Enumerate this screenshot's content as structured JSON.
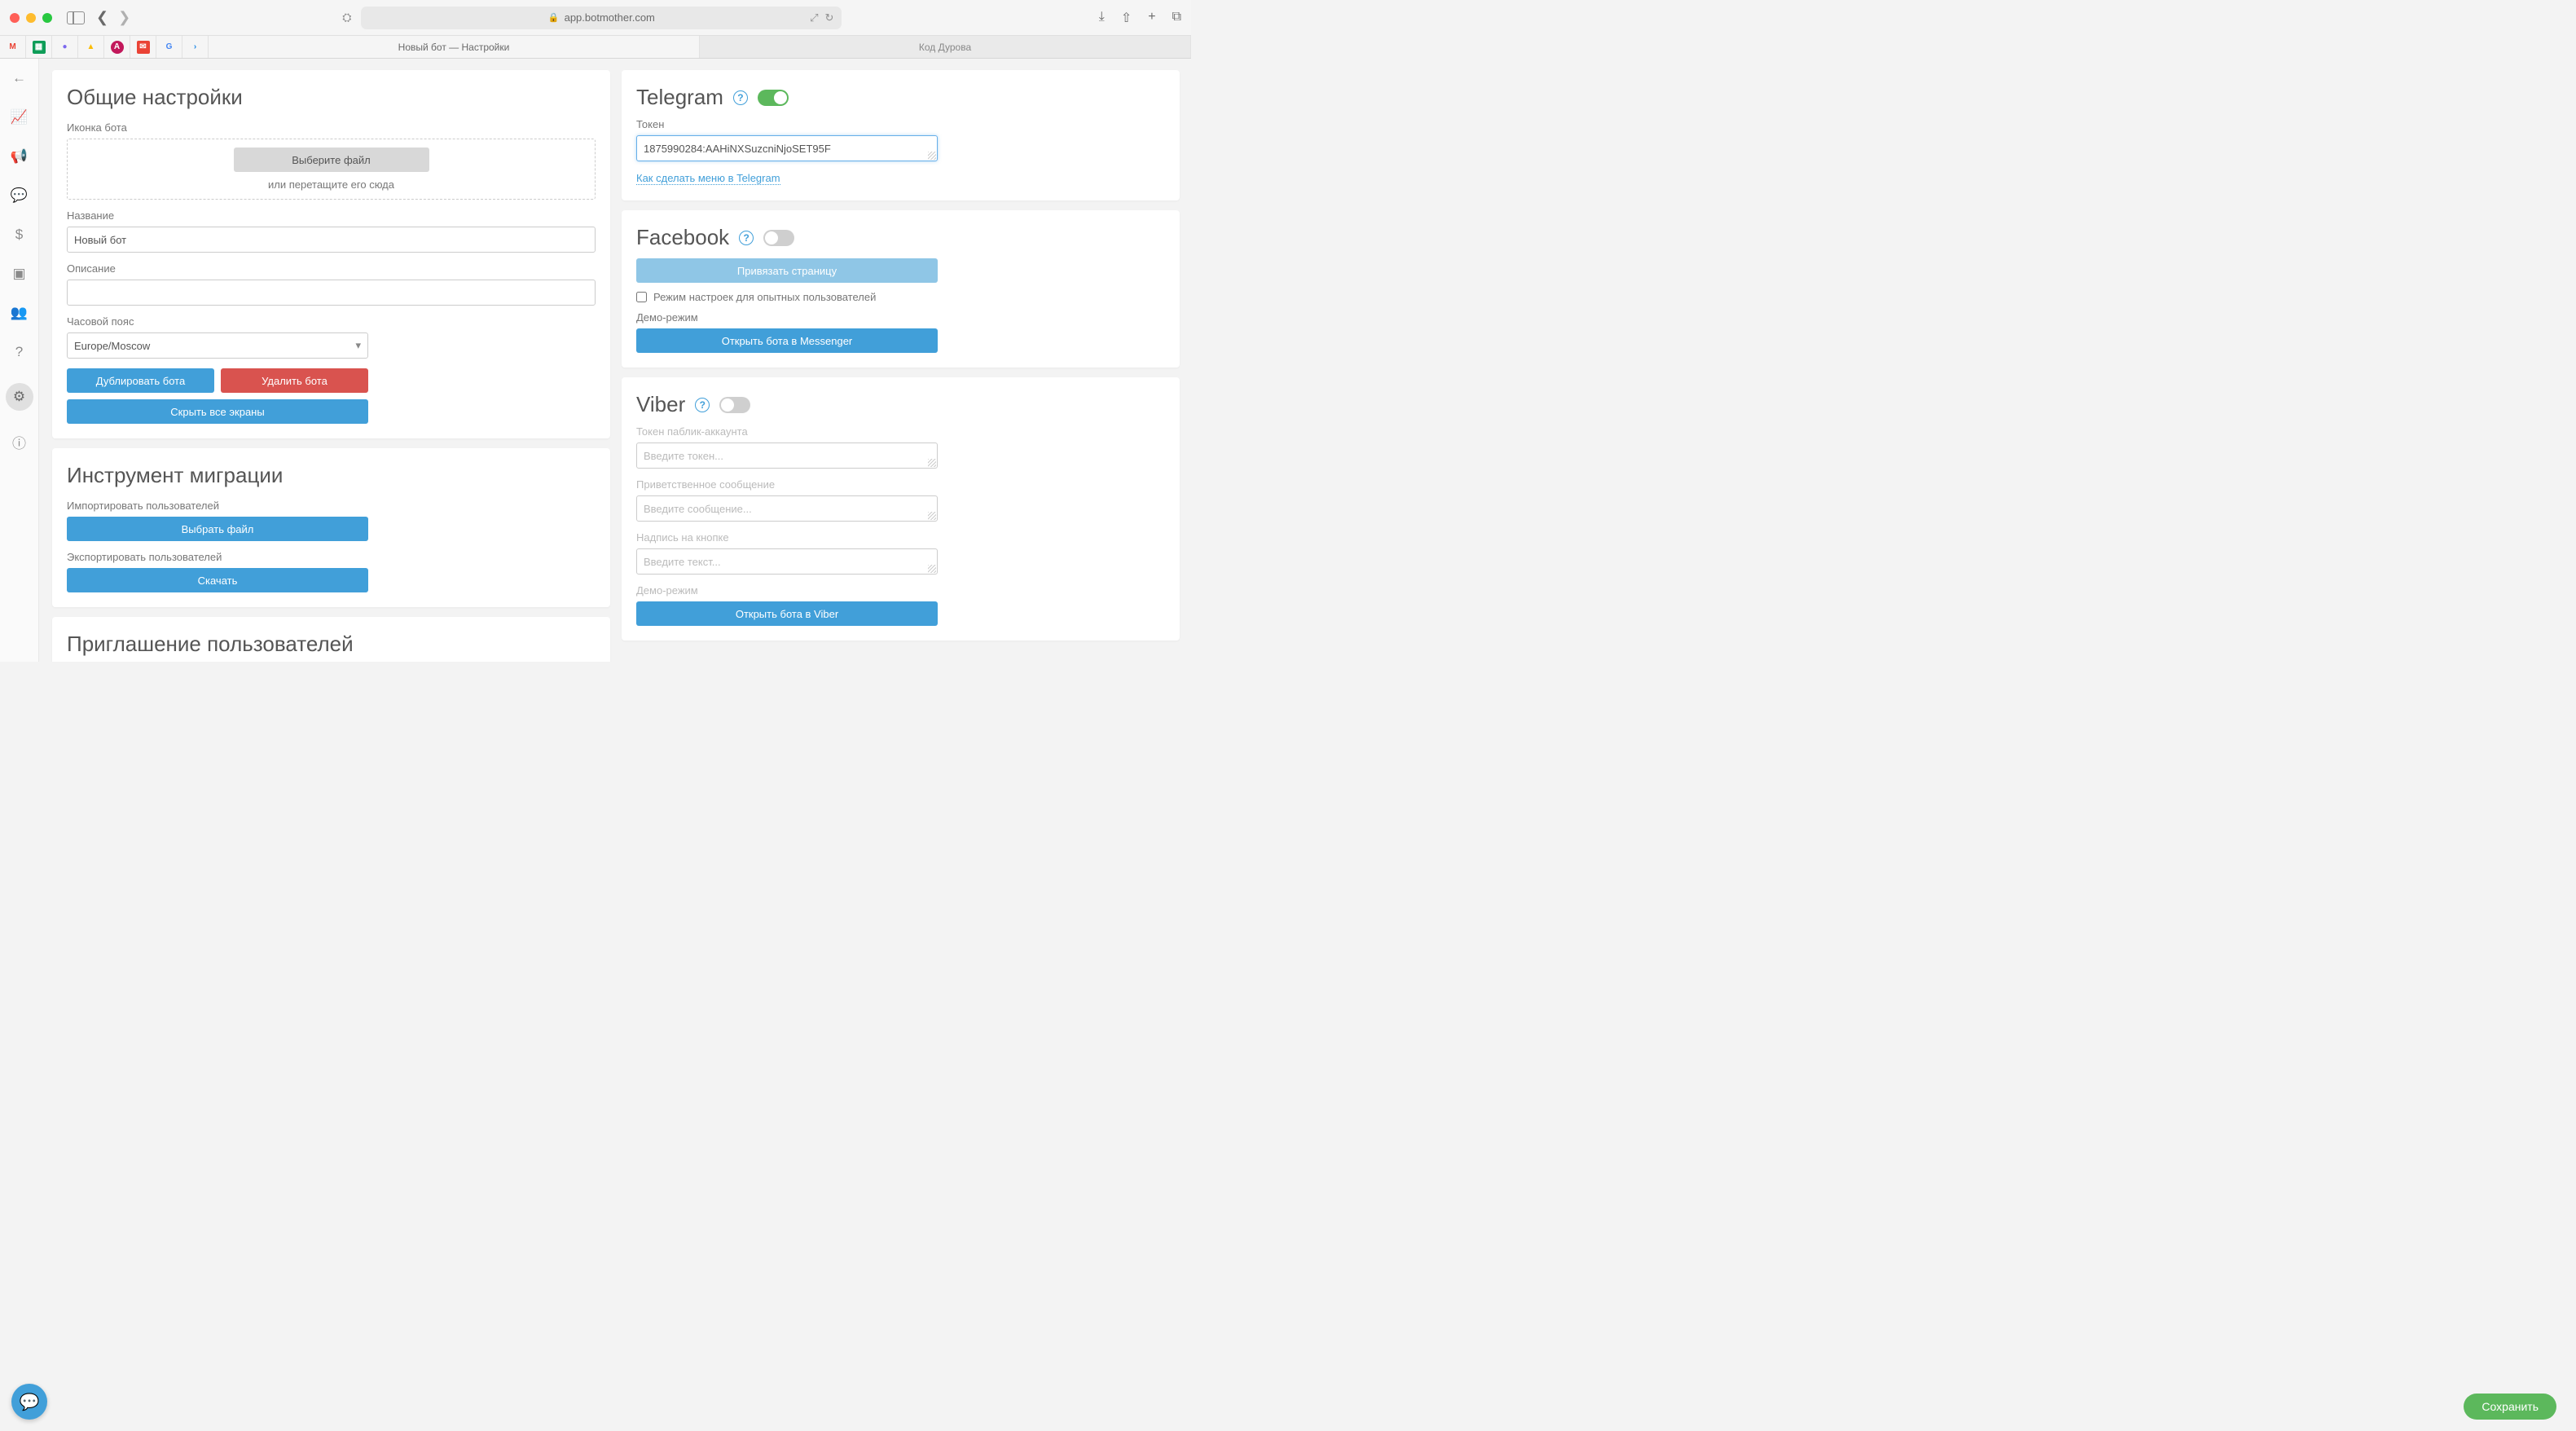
{
  "browser": {
    "url": "app.botmother.com"
  },
  "tabs": {
    "active": "Новый бот — Настройки",
    "inactive": "Код Дурова"
  },
  "general": {
    "title": "Общие настройки",
    "icon_label": "Иконка бота",
    "choose_file": "Выберите файл",
    "drag_hint": "или перетащите его сюда",
    "name_label": "Название",
    "name_value": "Новый бот",
    "desc_label": "Описание",
    "desc_value": "",
    "tz_label": "Часовой пояс",
    "tz_value": "Europe/Moscow",
    "duplicate": "Дублировать бота",
    "delete": "Удалить бота",
    "hide_all": "Скрыть все экраны"
  },
  "migration": {
    "title": "Инструмент миграции",
    "import_label": "Импортировать пользователей",
    "import_btn": "Выбрать файл",
    "export_label": "Экспортировать пользователей",
    "export_btn": "Скачать"
  },
  "invite": {
    "title": "Приглашение пользователей"
  },
  "telegram": {
    "title": "Telegram",
    "token_label": "Токен",
    "token_value": "1875990284:AAHiNXSuzcniNjoSET95F",
    "menu_link": "Как сделать меню в Telegram"
  },
  "facebook": {
    "title": "Facebook",
    "bind_page": "Привязать страницу",
    "advanced": "Режим настроек для опытных пользователей",
    "demo_label": "Демо-режим",
    "open_btn": "Открыть бота в Messenger"
  },
  "viber": {
    "title": "Viber",
    "token_label": "Токен паблик-аккаунта",
    "token_placeholder": "Введите токен...",
    "greet_label": "Приветственное сообщение",
    "greet_placeholder": "Введите сообщение...",
    "btn_label": "Надпись на кнопке",
    "btn_placeholder": "Введите текст...",
    "demo_label": "Демо-режим",
    "open_btn": "Открыть бота в Viber"
  },
  "save": "Сохранить"
}
